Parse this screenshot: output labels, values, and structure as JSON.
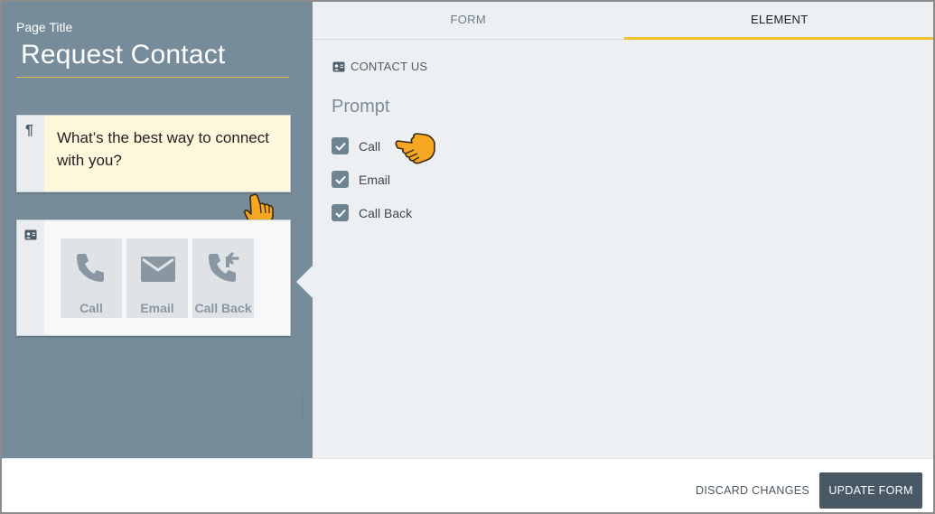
{
  "left_panel": {
    "page_title_label": "Page Title",
    "page_title_value": "Request Contact",
    "prompt_card": {
      "icon": "pilcrow-icon",
      "text": "What’s the best way to connect with you?"
    },
    "contact_card": {
      "icon": "contact-card-icon",
      "tiles": [
        {
          "label": "Call",
          "icon": "phone-icon"
        },
        {
          "label": "Email",
          "icon": "envelope-icon"
        },
        {
          "label": "Call Back",
          "icon": "callback-icon"
        }
      ]
    }
  },
  "right_panel": {
    "tabs": [
      {
        "label": "FORM",
        "active": false
      },
      {
        "label": "ELEMENT",
        "active": true
      }
    ],
    "section_title": "CONTACT US",
    "prompt_title": "Prompt",
    "options": [
      {
        "label": "Call",
        "checked": true
      },
      {
        "label": "Email",
        "checked": true
      },
      {
        "label": "Call Back",
        "checked": true
      }
    ]
  },
  "footer": {
    "discard_label": "DISCARD CHANGES",
    "update_label": "UPDATE FORM"
  },
  "colors": {
    "left_panel_bg": "#778c9a",
    "right_panel_bg": "#ecf0f3",
    "accent": "#f0c030",
    "checkbox": "#6f8493",
    "update_button": "#485965",
    "prompt_highlight": "#fff7dc"
  }
}
